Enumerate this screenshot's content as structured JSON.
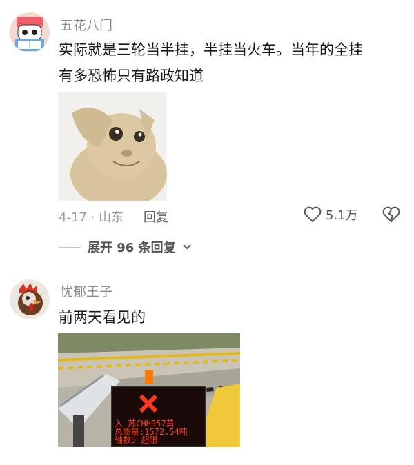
{
  "comments": [
    {
      "username": "五花八门",
      "lines": [
        "实际就是三轮当半挂，半挂当火车。当年的全挂",
        "有多恐怖只有路政知道"
      ],
      "date_location": "4-17 · 山东",
      "reply_label": "回复",
      "likes": "5.1万",
      "expand_label": "展开 96 条回复"
    },
    {
      "username": "忧郁王子",
      "lines": [
        "前两天看见的"
      ],
      "sign_lines": [
        "入 苏CHH957黄",
        "总质量:1572.54吨",
        "轴数5 超限"
      ]
    }
  ],
  "icons": {
    "heart": "heart-icon",
    "broken_heart": "broken-heart-icon",
    "chevron": "chevron-down-icon"
  },
  "colors": {
    "username": "#8a8a8a",
    "meta": "#9a9a9a",
    "sign_red": "#ff3b1f",
    "sign_bg": "#1a0a0a"
  }
}
